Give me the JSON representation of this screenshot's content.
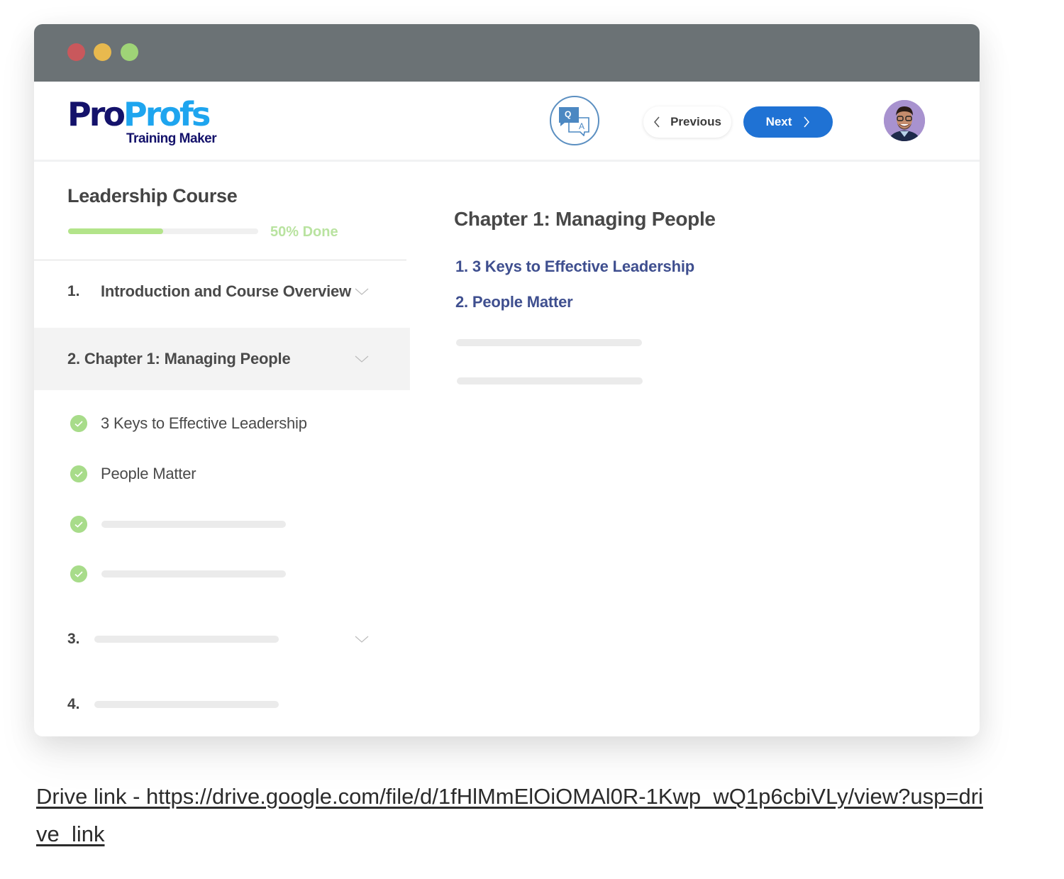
{
  "window": {
    "traffic_lights": [
      {
        "name": "close",
        "color": "#c9585c"
      },
      {
        "name": "minimize",
        "color": "#e8b94e"
      },
      {
        "name": "maximize",
        "color": "#9fd477"
      }
    ]
  },
  "header": {
    "logo": {
      "part1": "Pro",
      "part2": "Profs",
      "subtitle": "Training Maker"
    },
    "qa_icon": "qa-chat-icon",
    "previous_label": "Previous",
    "next_label": "Next",
    "avatar_icon": "user-avatar"
  },
  "colors": {
    "titlebar": "#6b7275",
    "logo_dark": "#14126b",
    "logo_light": "#1ea5ef",
    "next_button": "#1f72d4",
    "progress_fill": "#b3e48a",
    "check": "#a8dc8a",
    "content_link": "#3f4f8f"
  },
  "sidebar": {
    "course_title": "Leadership Course",
    "progress_percent": 50,
    "progress_label": "50% Done",
    "chapters": [
      {
        "number": "1.",
        "title": "Introduction and Course Overview",
        "expanded": false
      },
      {
        "number": "2.",
        "title": "2. Chapter 1: Managing People",
        "expanded": true,
        "lessons": [
          {
            "title": "3 Keys to Effective Leadership",
            "completed": true
          },
          {
            "title": "People Matter",
            "completed": true
          },
          {
            "title": "",
            "completed": true
          },
          {
            "title": "",
            "completed": true
          }
        ]
      },
      {
        "number": "3.",
        "title": "",
        "expanded": false
      },
      {
        "number": "4.",
        "title": "",
        "expanded": false
      }
    ]
  },
  "content": {
    "title": "Chapter 1: Managing People",
    "links": [
      "1. 3 Keys to Effective Leadership",
      "2. People Matter"
    ]
  },
  "footer": {
    "drive_link_text": "Drive link  - https://drive.google.com/file/d/1fHlMmElOiOMAl0R-1Kwp_wQ1p6cbiVLy/view?usp=drive_link"
  }
}
